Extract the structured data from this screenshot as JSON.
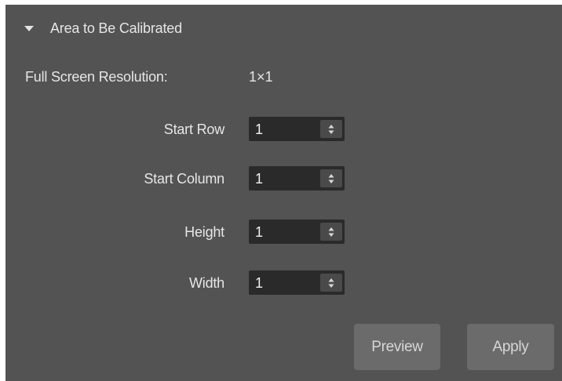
{
  "section": {
    "title": "Area to Be Calibrated",
    "expanded": true,
    "icon": "triangle-down-icon"
  },
  "resolution": {
    "label": "Full Screen Resolution:",
    "value": "1×1"
  },
  "fields": [
    {
      "label": "Start Row",
      "value": "1"
    },
    {
      "label": "Start Column",
      "value": "1"
    },
    {
      "label": "Height",
      "value": "1"
    },
    {
      "label": "Width",
      "value": "1"
    }
  ],
  "buttons": {
    "preview_label": "Preview",
    "apply_label": "Apply"
  },
  "colors": {
    "panel_bg": "#535353",
    "field_bg": "#2a2a2a",
    "button_bg": "#6b6b6b",
    "text": "#e6e6e6"
  }
}
